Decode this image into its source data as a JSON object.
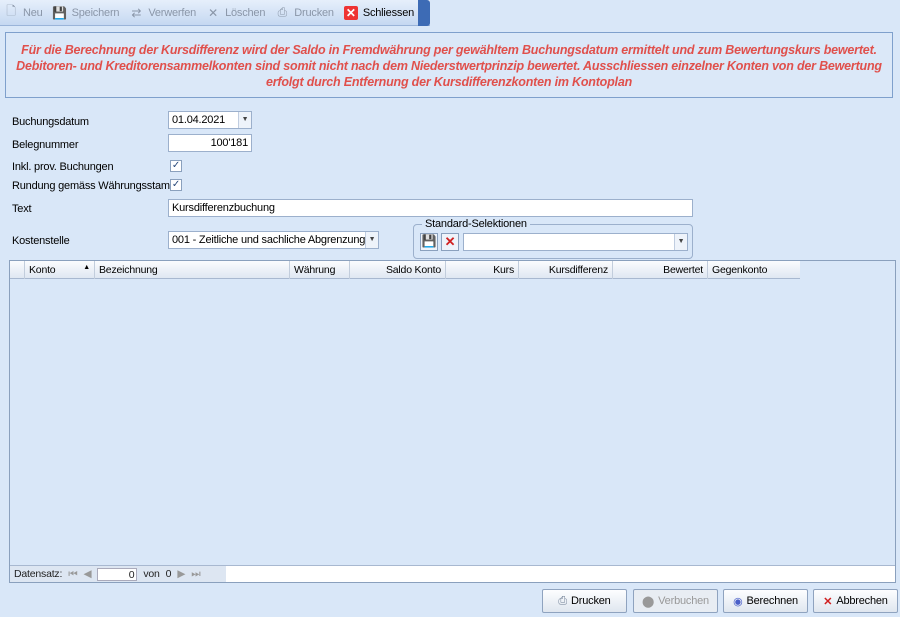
{
  "toolbar": {
    "new": "Neu",
    "save": "Speichern",
    "discard": "Verwerfen",
    "delete": "Löschen",
    "print": "Drucken",
    "close": "Schliessen"
  },
  "message": "Für die Berechnung der Kursdifferenz wird der Saldo in Fremdwährung per gewähltem Buchungsdatum ermittelt und zum Bewertungskurs bewertet. Debitoren- und Kreditorensammelkonten sind somit nicht nach dem Niederstwertprinzip bewertet. Ausschliessen einzelner Konten von der Bewertung erfolgt durch Entfernung der Kursdifferenzkonten im Kontoplan",
  "form": {
    "date_label": "Buchungsdatum",
    "date": "01.04.2021",
    "doc_label": "Belegnummer",
    "doc": "100'181",
    "prov_label": "Inkl. prov. Buchungen",
    "round_label": "Rundung gemäss Währungsstamm",
    "text_label": "Text",
    "text": "Kursdifferenzbuchung",
    "cost_label": "Kostenstelle",
    "cost": "001 - Zeitliche und sachliche Abgrenzung",
    "selections_label": "Standard-Selektionen",
    "selection": ""
  },
  "grid": {
    "columns": [
      "Konto",
      "Bezeichnung",
      "Währung",
      "Saldo Konto",
      "Kurs",
      "Kursdifferenz",
      "Bewertet",
      "Gegenkonto"
    ],
    "nav_label": "Datensatz:",
    "position": "0",
    "of_label": "von",
    "total": "0"
  },
  "buttons": {
    "print": "Drucken",
    "post": "Verbuchen",
    "calc": "Berechnen",
    "cancel": "Abbrechen"
  }
}
